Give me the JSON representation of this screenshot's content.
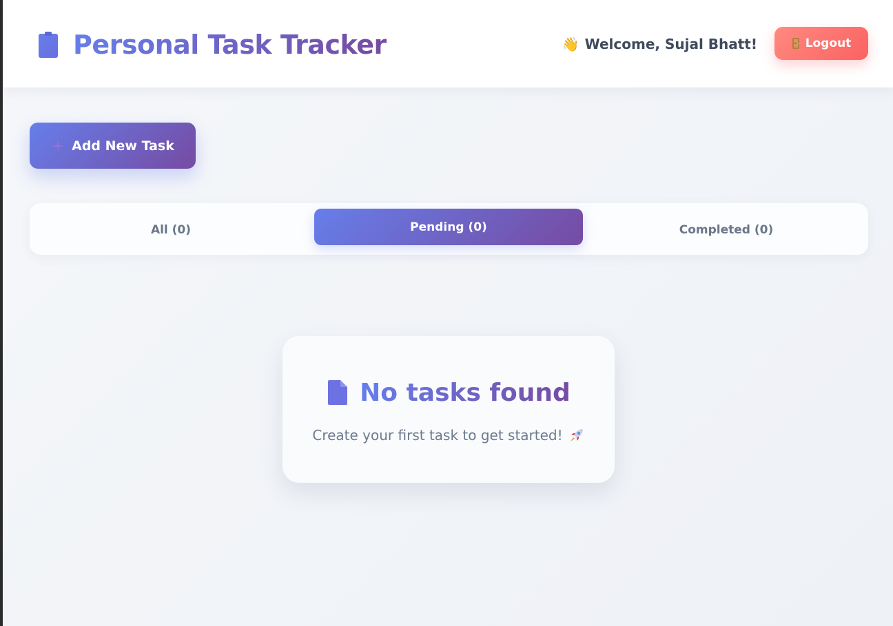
{
  "header": {
    "title": "Personal Task Tracker",
    "brand_icon": "clipboard-icon",
    "welcome_icon": "waving-hand-icon",
    "welcome_text": "Welcome, Sujal Bhatt!",
    "logout_icon": "door-icon",
    "logout_label": "Logout"
  },
  "actions": {
    "add_icon": "plus-icon",
    "add_label": "Add New Task"
  },
  "tabs": [
    {
      "label": "All (0)",
      "active": false
    },
    {
      "label": "Pending (0)",
      "active": true
    },
    {
      "label": "Completed (0)",
      "active": false
    }
  ],
  "empty_state": {
    "icon": "document-icon",
    "title": "No tasks found",
    "subtitle": "Create your first task to get started!",
    "subtitle_icon": "rocket-icon"
  },
  "colors": {
    "accent_start": "#667eea",
    "accent_end": "#764ba2",
    "logout_start": "#ff8a80",
    "logout_end": "#fb6262",
    "text_muted": "#6b7689"
  }
}
